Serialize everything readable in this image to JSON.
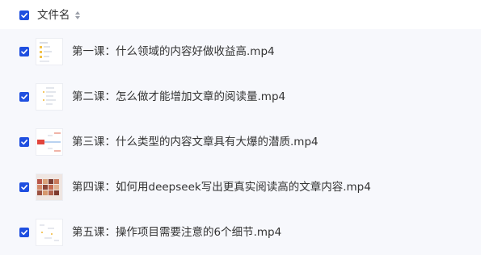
{
  "colors": {
    "checkbox": "#1f4fe0",
    "list_background": "#f7f8fc",
    "text": "#333333"
  },
  "header": {
    "column_label": "文件名",
    "sort_icon": "sort-icon",
    "checked": true
  },
  "files": [
    {
      "name": "第一课：什么领域的内容好做收益高.mp4",
      "checked": true
    },
    {
      "name": "第二课：怎么做才能增加文章的阅读量.mp4",
      "checked": true
    },
    {
      "name": "第三课：什么类型的内容文章具有大爆的潜质.mp4",
      "checked": true
    },
    {
      "name": "第四课：如何用deepseek写出更真实阅读高的文章内容.mp4",
      "checked": true
    },
    {
      "name": "第五课：操作项目需要注意的6个细节.mp4",
      "checked": true
    }
  ]
}
